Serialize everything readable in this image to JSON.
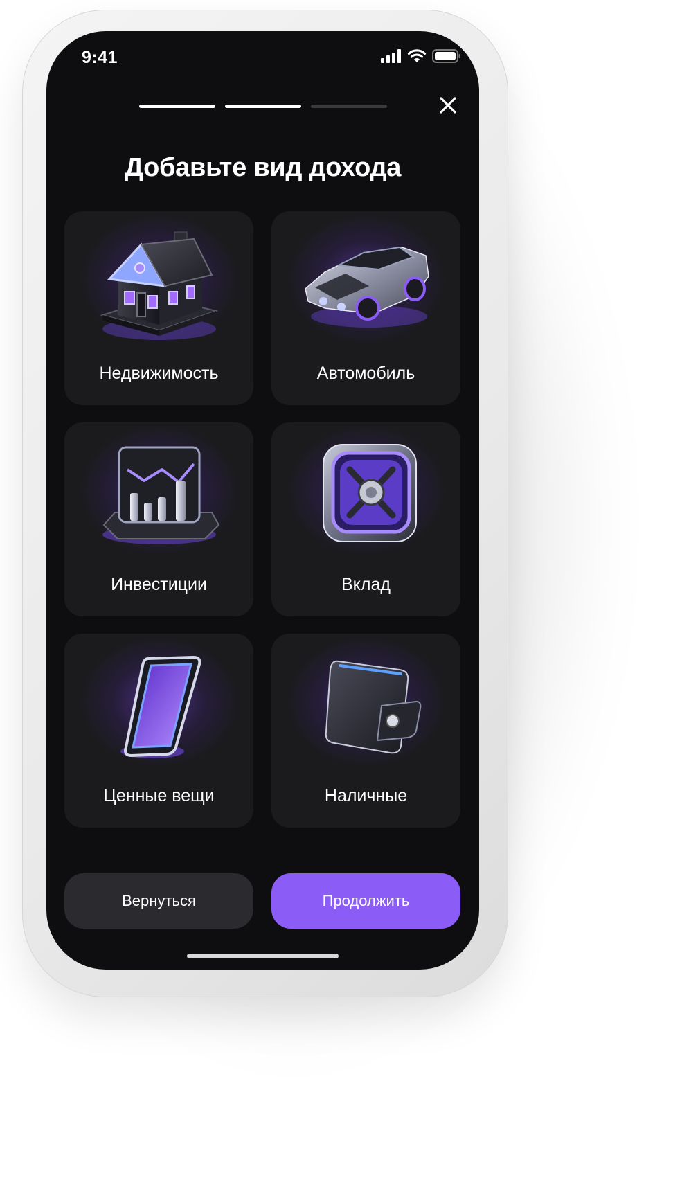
{
  "status_bar": {
    "time": "9:41",
    "signal_icon": "cellular-signal-icon",
    "wifi_icon": "wifi-icon",
    "battery_icon": "battery-icon"
  },
  "onboarding": {
    "progress": {
      "current_step": 2,
      "total_steps": 3
    },
    "close_icon": "close-icon",
    "title": "Добавьте вид дохода"
  },
  "income_types": [
    {
      "label": "Недвижимость",
      "icon": "house-icon"
    },
    {
      "label": "Автомобиль",
      "icon": "car-icon"
    },
    {
      "label": "Инвестиции",
      "icon": "investment-chart-icon"
    },
    {
      "label": "Вклад",
      "icon": "safe-icon"
    },
    {
      "label": "Ценные вещи",
      "icon": "smartphone-icon"
    },
    {
      "label": "Наличные",
      "icon": "wallet-icon"
    }
  ],
  "actions": {
    "back_label": "Вернуться",
    "continue_label": "Продолжить"
  },
  "colors": {
    "screen_background": "#0e0e10",
    "card_background": "#1b1b1e",
    "accent": "#8b5cf6",
    "secondary_button": "#2b2b2f",
    "progress_active": "#ffffff",
    "progress_inactive": "#3a3a3e"
  }
}
